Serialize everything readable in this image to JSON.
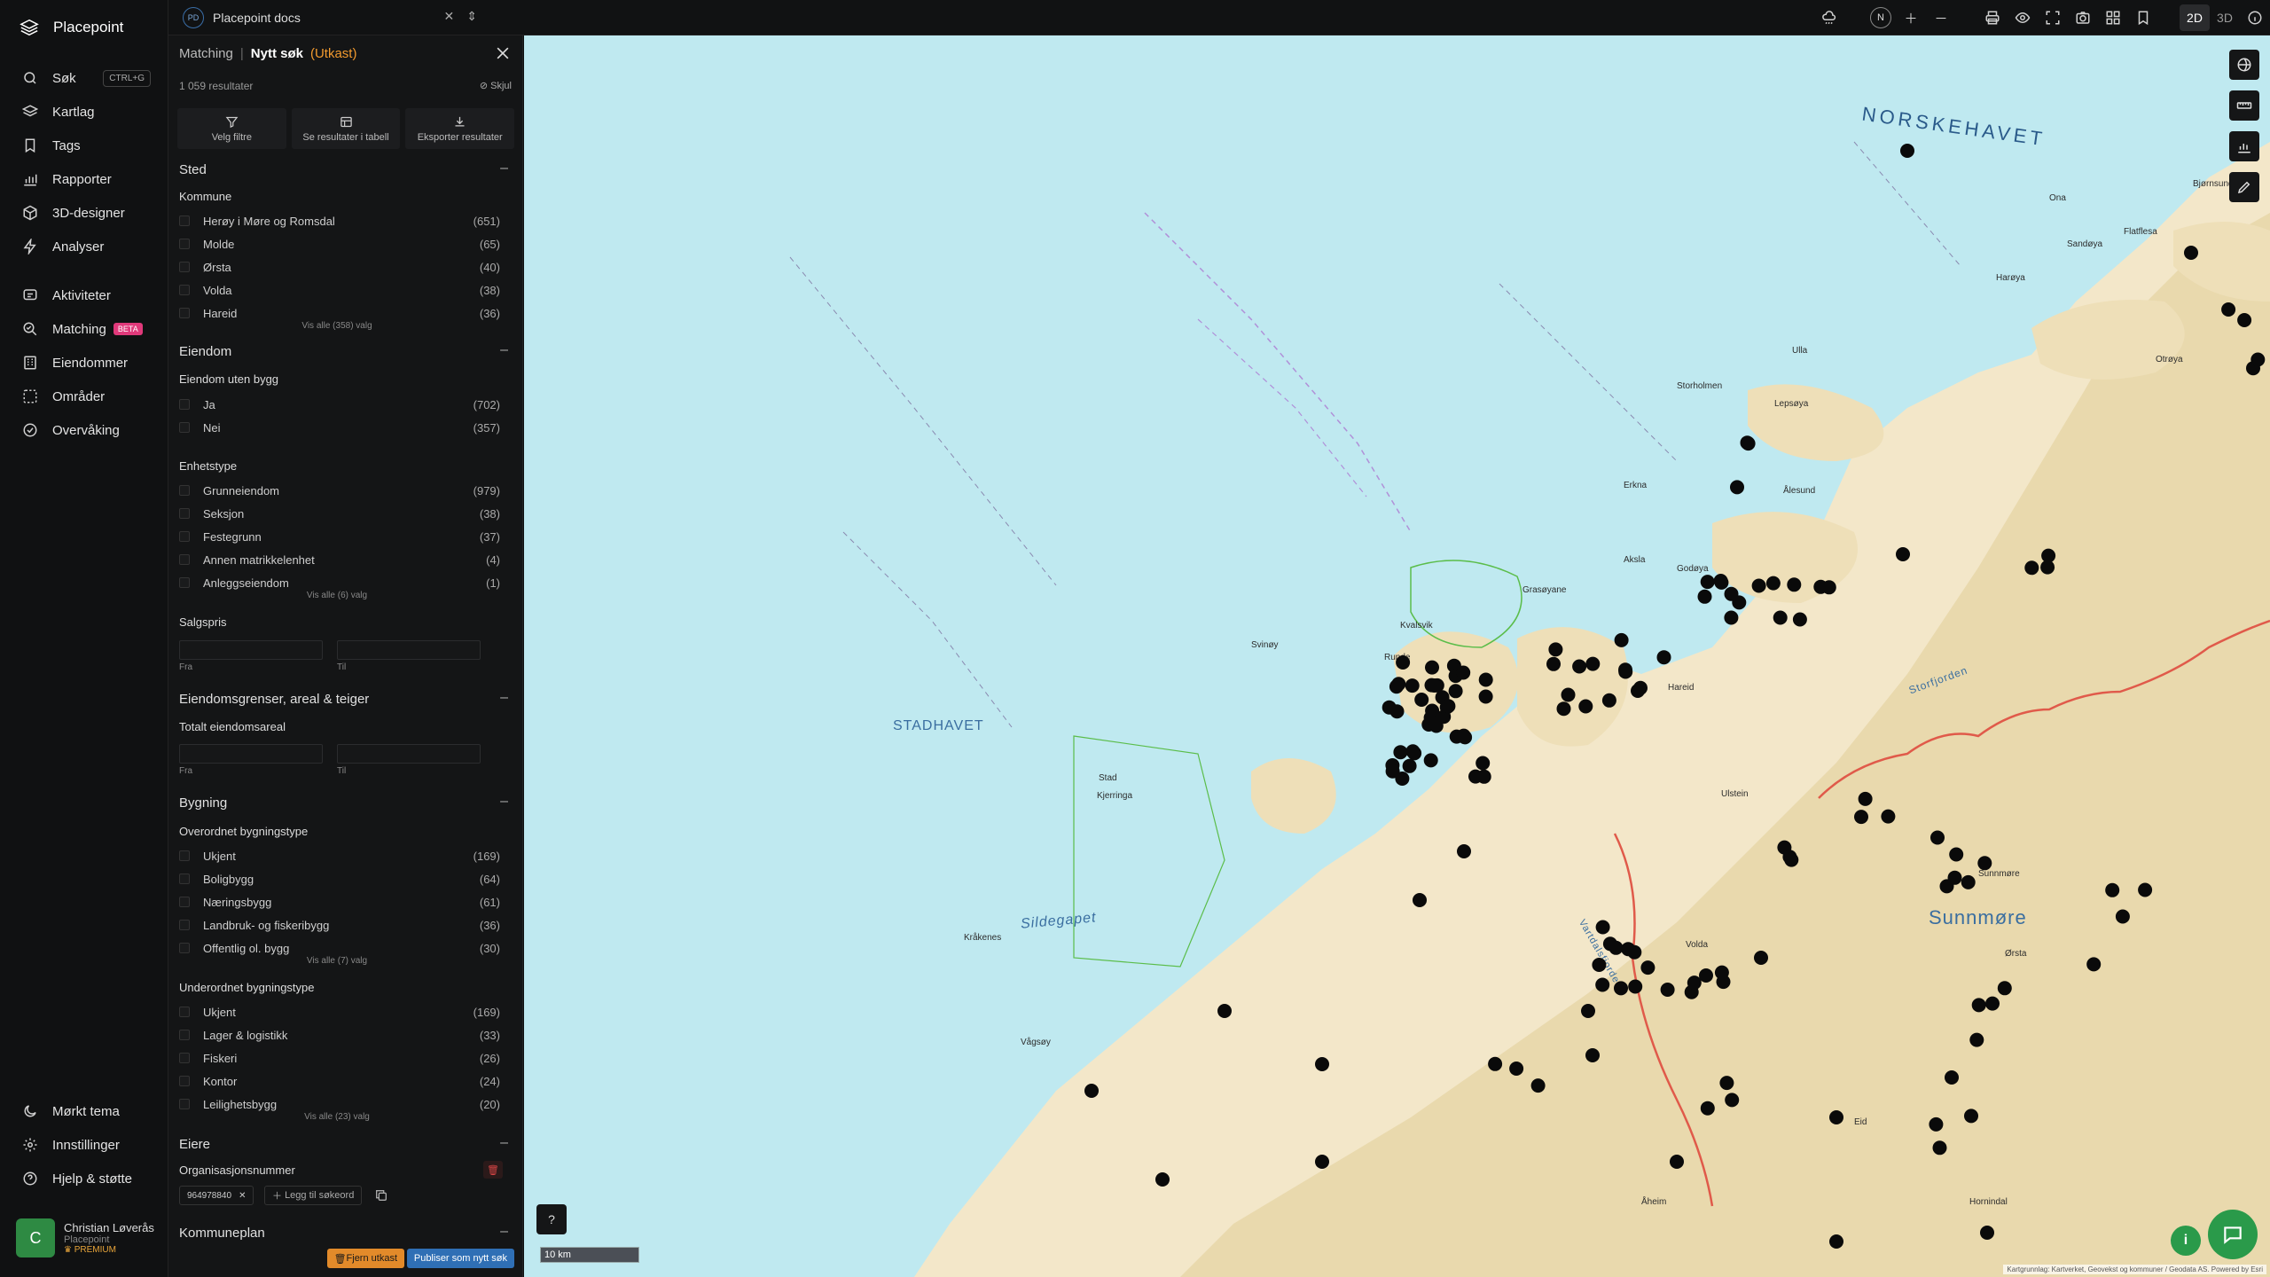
{
  "app": {
    "brand": "Placepoint",
    "nav_items": [
      {
        "label": "Søk",
        "icon": "search-icon",
        "shortcut": "CTRL+G"
      },
      {
        "label": "Kartlag",
        "icon": "layers-icon"
      },
      {
        "label": "Tags",
        "icon": "bookmark-icon"
      },
      {
        "label": "Rapporter",
        "icon": "bar-chart-icon"
      },
      {
        "label": "3D-designer",
        "icon": "cube-icon"
      },
      {
        "label": "Analyser",
        "icon": "lightning-icon"
      },
      {
        "label": "Aktiviteter",
        "icon": "activity-icon"
      },
      {
        "label": "Matching",
        "icon": "match-icon",
        "badge": "BETA"
      },
      {
        "label": "Eiendommer",
        "icon": "building-icon"
      },
      {
        "label": "Områder",
        "icon": "area-icon"
      },
      {
        "label": "Overvåking",
        "icon": "monitor-icon"
      }
    ],
    "footer_items": [
      {
        "label": "Mørkt tema",
        "icon": "moon-icon"
      },
      {
        "label": "Innstillinger",
        "icon": "gear-icon"
      },
      {
        "label": "Hjelp & støtte",
        "icon": "help-icon"
      }
    ],
    "user": {
      "initial": "C",
      "name": "Christian Løverås",
      "org": "Placepoint",
      "plan": "PREMIUM"
    }
  },
  "topbar": {
    "doc_badge": "PD",
    "doc_name": "Placepoint docs",
    "compass": "N",
    "mode_2d": "2D",
    "mode_3d": "3D"
  },
  "panel": {
    "crumb": "Matching",
    "separator": "|",
    "title": "Nytt søk",
    "draft": "(Utkast)",
    "result_count": "1 059 resultater",
    "hide_label": "Skjul",
    "actions": [
      {
        "label": "Velg filtre",
        "icon": "filter-icon"
      },
      {
        "label": "Se resultater i tabell",
        "icon": "table-icon"
      },
      {
        "label": "Eksporter resultater",
        "icon": "download-icon"
      }
    ],
    "sections": {
      "sted": {
        "title": "Sted",
        "kommune_title": "Kommune",
        "kommune": [
          {
            "label": "Herøy i Møre og Romsdal",
            "count": "(651)"
          },
          {
            "label": "Molde",
            "count": "(65)"
          },
          {
            "label": "Ørsta",
            "count": "(40)"
          },
          {
            "label": "Volda",
            "count": "(38)"
          },
          {
            "label": "Hareid",
            "count": "(36)"
          }
        ],
        "kommune_more": "Vis alle (358) valg"
      },
      "eiendom": {
        "title": "Eiendom",
        "uten_bygg_title": "Eiendom uten bygg",
        "uten_bygg": [
          {
            "label": "Ja",
            "count": "(702)"
          },
          {
            "label": "Nei",
            "count": "(357)"
          }
        ],
        "enhetstype_title": "Enhetstype",
        "enhetstype": [
          {
            "label": "Grunneiendom",
            "count": "(979)"
          },
          {
            "label": "Seksjon",
            "count": "(38)"
          },
          {
            "label": "Festegrunn",
            "count": "(37)"
          },
          {
            "label": "Annen matrikkelenhet",
            "count": "(4)"
          },
          {
            "label": "Anleggseiendom",
            "count": "(1)"
          }
        ],
        "enhetstype_more": "Vis alle (6) valg",
        "salgspris_title": "Salgspris",
        "from": "Fra",
        "to": "Til"
      },
      "grenser": {
        "title": "Eiendomsgrenser, areal & teiger",
        "areal_title": "Totalt eiendomsareal",
        "from": "Fra",
        "to": "Til"
      },
      "bygning": {
        "title": "Bygning",
        "overordnet_title": "Overordnet bygningstype",
        "overordnet": [
          {
            "label": "Ukjent",
            "count": "(169)"
          },
          {
            "label": "Boligbygg",
            "count": "(64)"
          },
          {
            "label": "Næringsbygg",
            "count": "(61)"
          },
          {
            "label": "Landbruk- og fiskeribygg",
            "count": "(36)"
          },
          {
            "label": "Offentlig ol. bygg",
            "count": "(30)"
          }
        ],
        "overordnet_more": "Vis alle (7) valg",
        "underordnet_title": "Underordnet bygningstype",
        "underordnet": [
          {
            "label": "Ukjent",
            "count": "(169)"
          },
          {
            "label": "Lager & logistikk",
            "count": "(33)"
          },
          {
            "label": "Fiskeri",
            "count": "(26)"
          },
          {
            "label": "Kontor",
            "count": "(24)"
          },
          {
            "label": "Leilighetsbygg",
            "count": "(20)"
          }
        ],
        "underordnet_more": "Vis alle (23) valg"
      },
      "eiere": {
        "title": "Eiere",
        "org_title": "Organisasjonsnummer",
        "org_chip": "964978840",
        "add_keyword": "Legg til søkeord"
      },
      "kommuneplan": {
        "title": "Kommuneplan"
      }
    },
    "buttons": {
      "remove": "Fjern utkast",
      "publish": "Publiser som nytt søk"
    }
  },
  "map": {
    "labels": {
      "norskehavet": "NORSKEHAVET",
      "stadhavet": "STADHAVET",
      "sunnmore": "Sunnmøre",
      "sildegapet": "Sildegapet",
      "storfjorden": "Storfjorden",
      "vartdalsfjorden": "Vartdalsfjorden"
    },
    "places": [
      "Ona",
      "Bjørnsund",
      "Flatflesa",
      "Sandøya",
      "Harøya",
      "Ulla",
      "Storholmen",
      "Lepsøya",
      "Godøya",
      "Aksla",
      "Ålesund",
      "Erkna",
      "Grasøyane",
      "Kvalsvik",
      "Runde",
      "Svinøy",
      "Stad",
      "Kjerringa",
      "Sunnmøre",
      "Ørsta",
      "Volda",
      "Eid",
      "Hornindal",
      "Åheim",
      "Kråkenes",
      "Vågsøy",
      "Hareid",
      "Ulstein",
      "Otrøya"
    ],
    "scale": "10 km",
    "attribution": "Kartgrunnlag: Kartverket, Geovekst og kommuner / Geodata AS. Powered by Esri"
  }
}
